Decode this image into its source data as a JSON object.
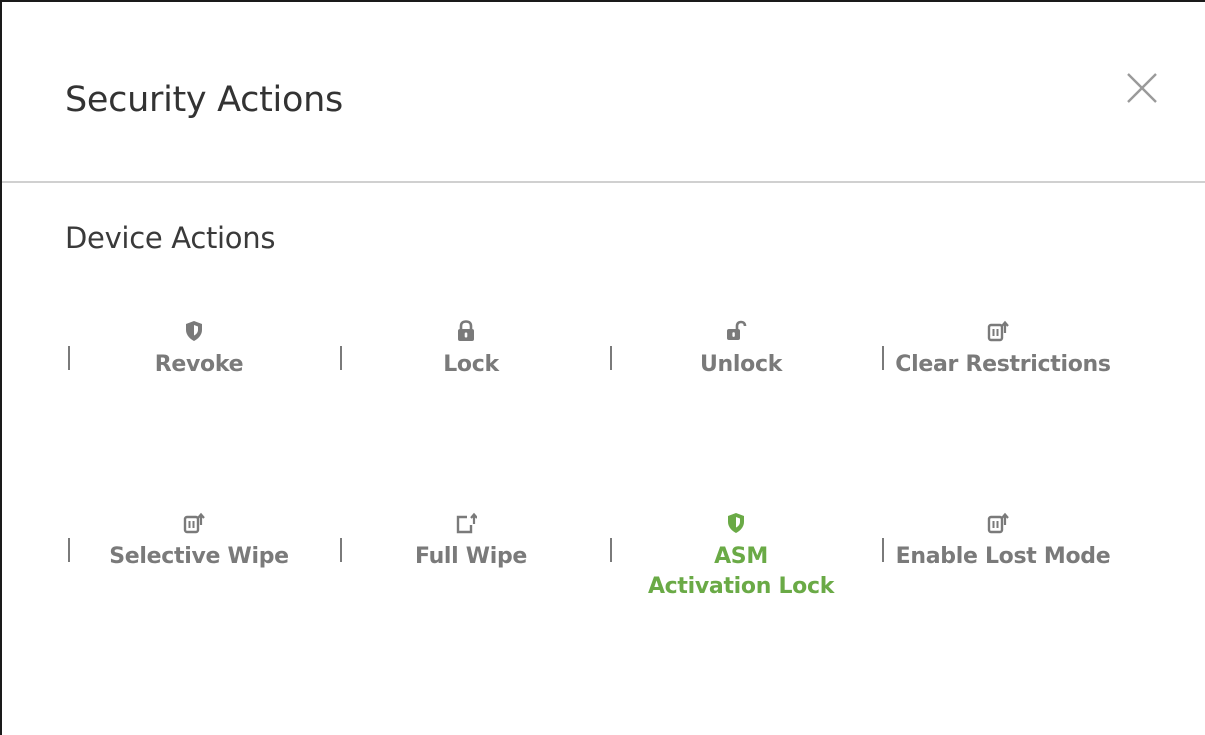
{
  "dialog": {
    "title": "Security Actions",
    "close_icon": "close-icon"
  },
  "section": {
    "title": "Device Actions"
  },
  "actions": [
    {
      "label": "Revoke",
      "icon": "shield-icon",
      "color": "#7a7a7a"
    },
    {
      "label": "Lock",
      "icon": "lock-icon",
      "color": "#7a7a7a"
    },
    {
      "label": "Unlock",
      "icon": "unlock-icon",
      "color": "#7a7a7a"
    },
    {
      "label": "Clear Restrictions",
      "icon": "device-arrow-icon",
      "color": "#7a7a7a"
    },
    {
      "label": "Selective Wipe",
      "icon": "device-arrow-icon",
      "color": "#7a7a7a"
    },
    {
      "label": "Full Wipe",
      "icon": "export-icon",
      "color": "#7a7a7a"
    },
    {
      "label_line1": "ASM",
      "label_line2": "Activation Lock",
      "icon": "shield-icon",
      "color": "#6aaa46"
    },
    {
      "label": "Enable Lost Mode",
      "icon": "device-arrow-icon",
      "color": "#7a7a7a"
    }
  ],
  "colors": {
    "text_primary": "#333333",
    "action_gray": "#7a7a7a",
    "action_green": "#6aaa46",
    "divider": "#d0d0d0"
  }
}
